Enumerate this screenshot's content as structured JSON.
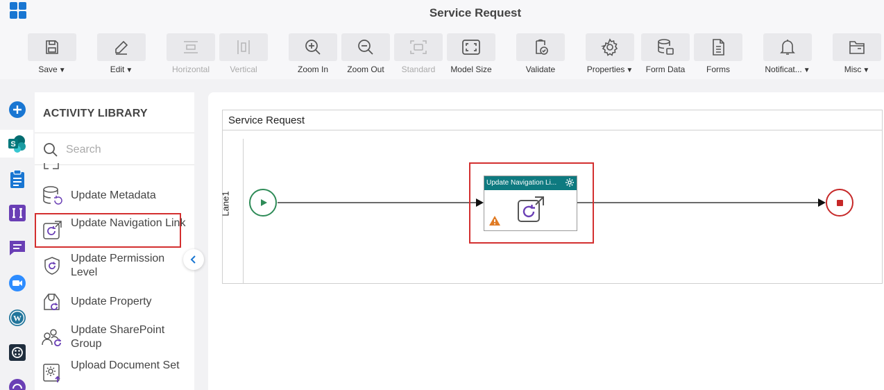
{
  "app": {
    "title": "Service Request"
  },
  "toolbar": {
    "items": [
      {
        "label": "Save",
        "icon": "save-icon",
        "has_caret": true,
        "enabled": true
      },
      {
        "label": "Edit",
        "icon": "edit-icon",
        "has_caret": true,
        "enabled": true
      },
      {
        "label": "Horizontal",
        "icon": "horizontal-icon",
        "has_caret": false,
        "enabled": false
      },
      {
        "label": "Vertical",
        "icon": "vertical-icon",
        "has_caret": false,
        "enabled": false
      },
      {
        "label": "Zoom In",
        "icon": "zoom-in-icon",
        "has_caret": false,
        "enabled": true
      },
      {
        "label": "Zoom Out",
        "icon": "zoom-out-icon",
        "has_caret": false,
        "enabled": true
      },
      {
        "label": "Standard",
        "icon": "standard-icon",
        "has_caret": false,
        "enabled": false
      },
      {
        "label": "Model Size",
        "icon": "model-size-icon",
        "has_caret": false,
        "enabled": true
      },
      {
        "label": "Validate",
        "icon": "validate-icon",
        "has_caret": false,
        "enabled": true
      },
      {
        "label": "Properties",
        "icon": "gear-icon",
        "has_caret": true,
        "enabled": true
      },
      {
        "label": "Form Data",
        "icon": "database-icon",
        "has_caret": false,
        "enabled": true
      },
      {
        "label": "Forms",
        "icon": "forms-icon",
        "has_caret": false,
        "enabled": true
      },
      {
        "label": "Notificat...",
        "icon": "bell-icon",
        "has_caret": true,
        "enabled": true
      },
      {
        "label": "Misc",
        "icon": "folder-icon",
        "has_caret": true,
        "enabled": true
      }
    ]
  },
  "rail": {
    "items": [
      "add-icon",
      "sharepoint-icon",
      "clipboard-icon",
      "integration-icon",
      "chat-icon",
      "video-icon",
      "wordpress-icon",
      "app-icon",
      "support-icon"
    ],
    "active": "sharepoint-icon"
  },
  "library": {
    "title": "ACTIVITY LIBRARY",
    "search_placeholder": "Search",
    "items": [
      {
        "label": "Update Metadata",
        "icon": "metadata-icon"
      },
      {
        "label": "Update Navigation Link",
        "icon": "navigation-link-icon",
        "selected": true
      },
      {
        "label": "Update Permission Level",
        "icon": "permission-icon"
      },
      {
        "label": "Update Property",
        "icon": "property-icon"
      },
      {
        "label": "Update SharePoint Group",
        "icon": "group-icon"
      },
      {
        "label": "Upload Document Set",
        "icon": "upload-document-icon"
      }
    ]
  },
  "canvas": {
    "pool_title": "Service Request",
    "lane_label": "Lane1",
    "task": {
      "title": "Update Navigation Li...",
      "warning": true
    },
    "colors": {
      "task_header": "#0e7a80",
      "start": "#2e8b57",
      "end": "#c62828",
      "highlight": "#d32f2f",
      "accent": "#1976d2"
    }
  }
}
